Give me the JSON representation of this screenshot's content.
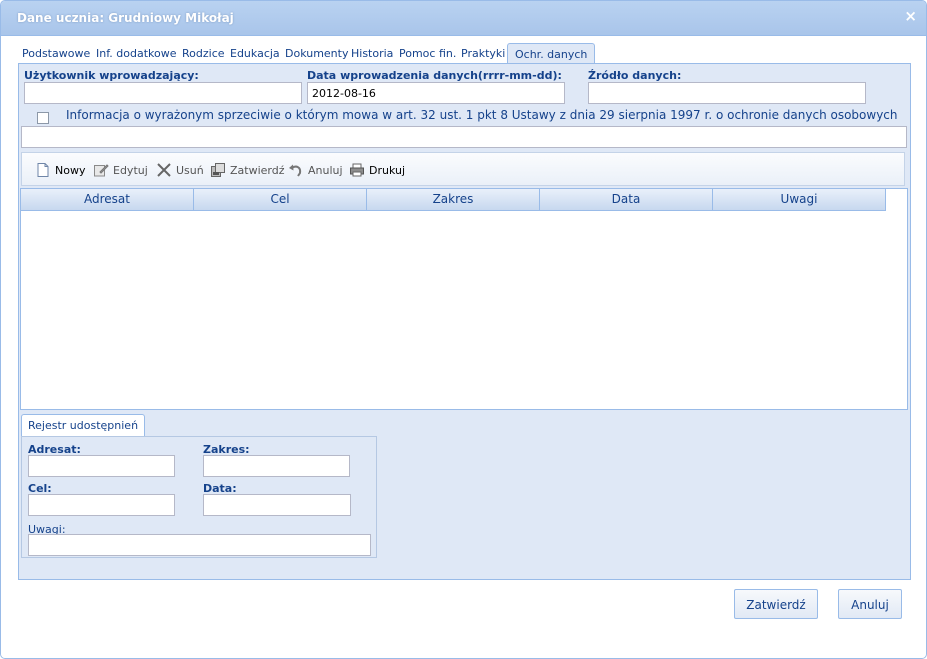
{
  "window": {
    "title": "Dane ucznia: Grudniowy Mikołaj",
    "close_glyph": "×"
  },
  "tabs": [
    {
      "label": "Podstawowe"
    },
    {
      "label": "Inf. dodatkowe"
    },
    {
      "label": "Rodzice"
    },
    {
      "label": "Edukacja"
    },
    {
      "label": "Dokumenty"
    },
    {
      "label": "Historia"
    },
    {
      "label": "Pomoc fin."
    },
    {
      "label": "Praktyki"
    },
    {
      "label": "Ochr. danych"
    }
  ],
  "form": {
    "user_label": "Użytkownik wprowadzający:",
    "user_value": "",
    "date_label": "Data wprowadzenia danych(rrrr-mm-dd):",
    "date_value": "2012-08-16",
    "source_label": "Źródło danych:",
    "source_value": "",
    "objection_text": "Informacja o wyrażonym sprzeciwie o którym mowa w art. 32 ust. 1 pkt 8 Ustawy z dnia 29 sierpnia 1997 r. o ochronie danych osobowych",
    "objection_value": ""
  },
  "toolbar": {
    "new_label": "Nowy",
    "edit_label": "Edytuj",
    "delete_label": "Usuń",
    "confirm_label": "Zatwierdź",
    "cancel_label": "Anuluj",
    "print_label": "Drukuj"
  },
  "grid": {
    "columns": [
      "Adresat",
      "Cel",
      "Zakres",
      "Data",
      "Uwagi"
    ],
    "rows": []
  },
  "register": {
    "tab_label": "Rejestr udostępnień",
    "addressee_label": "Adresat:",
    "scope_label": "Zakres:",
    "purpose_label": "Cel:",
    "date_label": "Data:",
    "notes_label": "Uwagi:"
  },
  "footer": {
    "confirm_label": "Zatwierdź",
    "cancel_label": "Anuluj"
  },
  "colors": {
    "accent": "#15428b",
    "panel": "#dfe8f6",
    "border": "#99bbe8"
  },
  "icons": [
    "close-icon",
    "new-document-icon",
    "edit-icon",
    "delete-x-icon",
    "confirm-icon",
    "undo-icon",
    "printer-icon"
  ]
}
